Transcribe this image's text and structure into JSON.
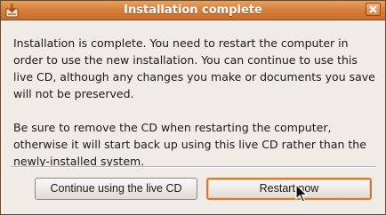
{
  "dialog": {
    "title": "Installation complete",
    "message_paragraph_1": "Installation is complete. You need to restart the computer in order to use the new installation. You can continue to use this live CD, although any changes you make or documents you save will not be preserved.",
    "message_paragraph_2": "Be sure to remove the CD when restarting the computer, otherwise it will start back up using this live CD rather than the newly-installed system.",
    "buttons": {
      "continue_label": "Continue using the live CD",
      "restart_label": "Restart now"
    }
  },
  "colors": {
    "titlebar_accent": "#d8803d",
    "focus_ring": "#d1793a",
    "window_background": "#efebe7"
  },
  "icons": {
    "title_icon": "installer-icon",
    "close_icon": "close-icon",
    "cursor_icon": "mouse-pointer-icon"
  }
}
